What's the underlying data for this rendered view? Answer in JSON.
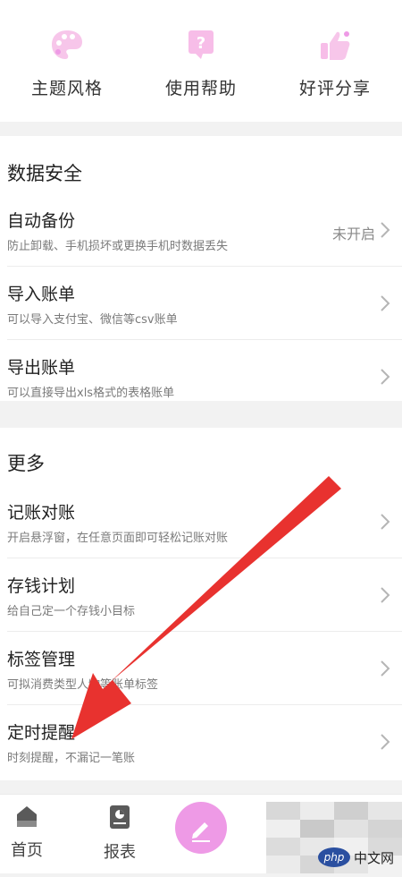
{
  "quick_actions": [
    {
      "label": "主题风格",
      "icon": "palette-icon"
    },
    {
      "label": "使用帮助",
      "icon": "help-bubble-icon"
    },
    {
      "label": "好评分享",
      "icon": "thumbs-up-icon"
    }
  ],
  "data_security": {
    "title": "数据安全",
    "items": [
      {
        "title": "自动备份",
        "desc": "防止卸载、手机损坏或更换手机时数据丢失",
        "status": "未开启"
      },
      {
        "title": "导入账单",
        "desc": "可以导入支付宝、微信等csv账单"
      },
      {
        "title": "导出账单",
        "desc": "可以直接导出xls格式的表格账单"
      }
    ]
  },
  "more": {
    "title": "更多",
    "items": [
      {
        "title": "记账对账",
        "desc": "开启悬浮窗，在任意页面即可轻松记账对账"
      },
      {
        "title": "存钱计划",
        "desc": "给自己定一个存钱小目标"
      },
      {
        "title": "标签管理",
        "desc": "可拟消费类型人物等账单标签"
      },
      {
        "title": "定时提醒",
        "desc": "时刻提醒，不漏记一笔账"
      }
    ]
  },
  "bottom_nav": [
    {
      "label": "首页",
      "icon": "home-icon"
    },
    {
      "label": "报表",
      "icon": "report-icon"
    }
  ],
  "watermark": {
    "logo": "php",
    "text": "中文网"
  },
  "colors": {
    "accent_pink": "#ee9ae6",
    "icon_pink": "#f7bde8",
    "arrow_red": "#e8322f"
  }
}
